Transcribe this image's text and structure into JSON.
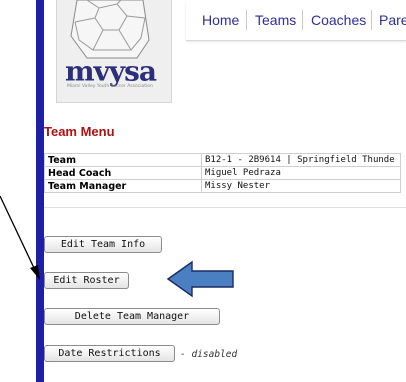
{
  "logo": {
    "wordmark": "mvysa",
    "subtitle": "Miami Valley Youth Soccer Association",
    "icon": "soccer-ball-map-icon"
  },
  "nav": {
    "items": [
      "Home",
      "Teams",
      "Coaches",
      "Pare"
    ]
  },
  "team_menu": {
    "title": "Team Menu",
    "rows": [
      {
        "label": "Team",
        "value": "B12-1 - 2B9614 | Springfield Thunde"
      },
      {
        "label": "Head Coach",
        "value": "Miguel Pedraza"
      },
      {
        "label": "Team Manager",
        "value": "Missy Nester"
      }
    ]
  },
  "buttons": {
    "edit_team_info": "Edit Team Info",
    "edit_roster": "Edit Roster",
    "delete_team_manager": "Delete Team Manager",
    "date_restrictions": "Date Restrictions",
    "date_restrictions_note": "- disabled"
  },
  "annotations": {
    "color": "#4a7fc1",
    "arrow_icon": "left-pointing-block-arrow",
    "pointer_icon": "black-diagonal-arrow"
  }
}
